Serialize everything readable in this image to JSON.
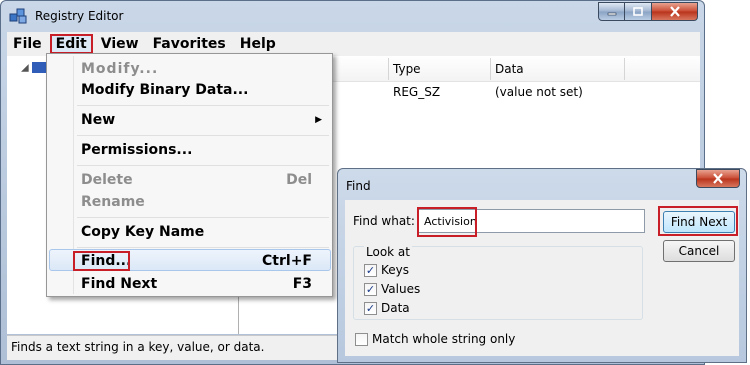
{
  "app": {
    "title": "Registry Editor"
  },
  "menubar": {
    "items": [
      "File",
      "Edit",
      "View",
      "Favorites",
      "Help"
    ],
    "active": "Edit"
  },
  "list": {
    "columns": [
      "Type",
      "Data"
    ],
    "rows": [
      {
        "type": "REG_SZ",
        "data": "(value not set)"
      }
    ]
  },
  "status_bar": {
    "text": "Finds a text string in a key, value, or data."
  },
  "edit_menu": {
    "items": [
      {
        "label": "Modify...",
        "enabled": false
      },
      {
        "label": "Modify Binary Data...",
        "enabled": true
      },
      {
        "label": "New",
        "enabled": true,
        "submenu": true
      },
      {
        "label": "Permissions...",
        "enabled": true
      },
      {
        "label": "Delete",
        "shortcut": "Del",
        "enabled": false
      },
      {
        "label": "Rename",
        "enabled": false
      },
      {
        "label": "Copy Key Name",
        "enabled": true
      },
      {
        "label": "Find...",
        "shortcut": "Ctrl+F",
        "enabled": true,
        "highlighted": true
      },
      {
        "label": "Find Next",
        "shortcut": "F3",
        "enabled": true
      }
    ]
  },
  "find_dialog": {
    "title": "Find",
    "find_what_label": "Find what:",
    "find_what_value": "Activision",
    "find_next_label": "Find Next",
    "cancel_label": "Cancel",
    "look_at_label": "Look at",
    "options": [
      {
        "label": "Keys",
        "checked": true
      },
      {
        "label": "Values",
        "checked": true
      },
      {
        "label": "Data",
        "checked": true
      }
    ],
    "match_whole_label": "Match whole string only",
    "match_whole_checked": false
  },
  "colors": {
    "highlight_outline": "#c81e28",
    "title_bar": "#b7c8de",
    "menu_highlight": "#dbe8f7"
  },
  "icons": {
    "app": "registry-cubes-icon",
    "minimize": "minimize-icon",
    "maximize": "maximize-icon",
    "close": "close-icon",
    "submenu": "chevron-right-icon"
  }
}
